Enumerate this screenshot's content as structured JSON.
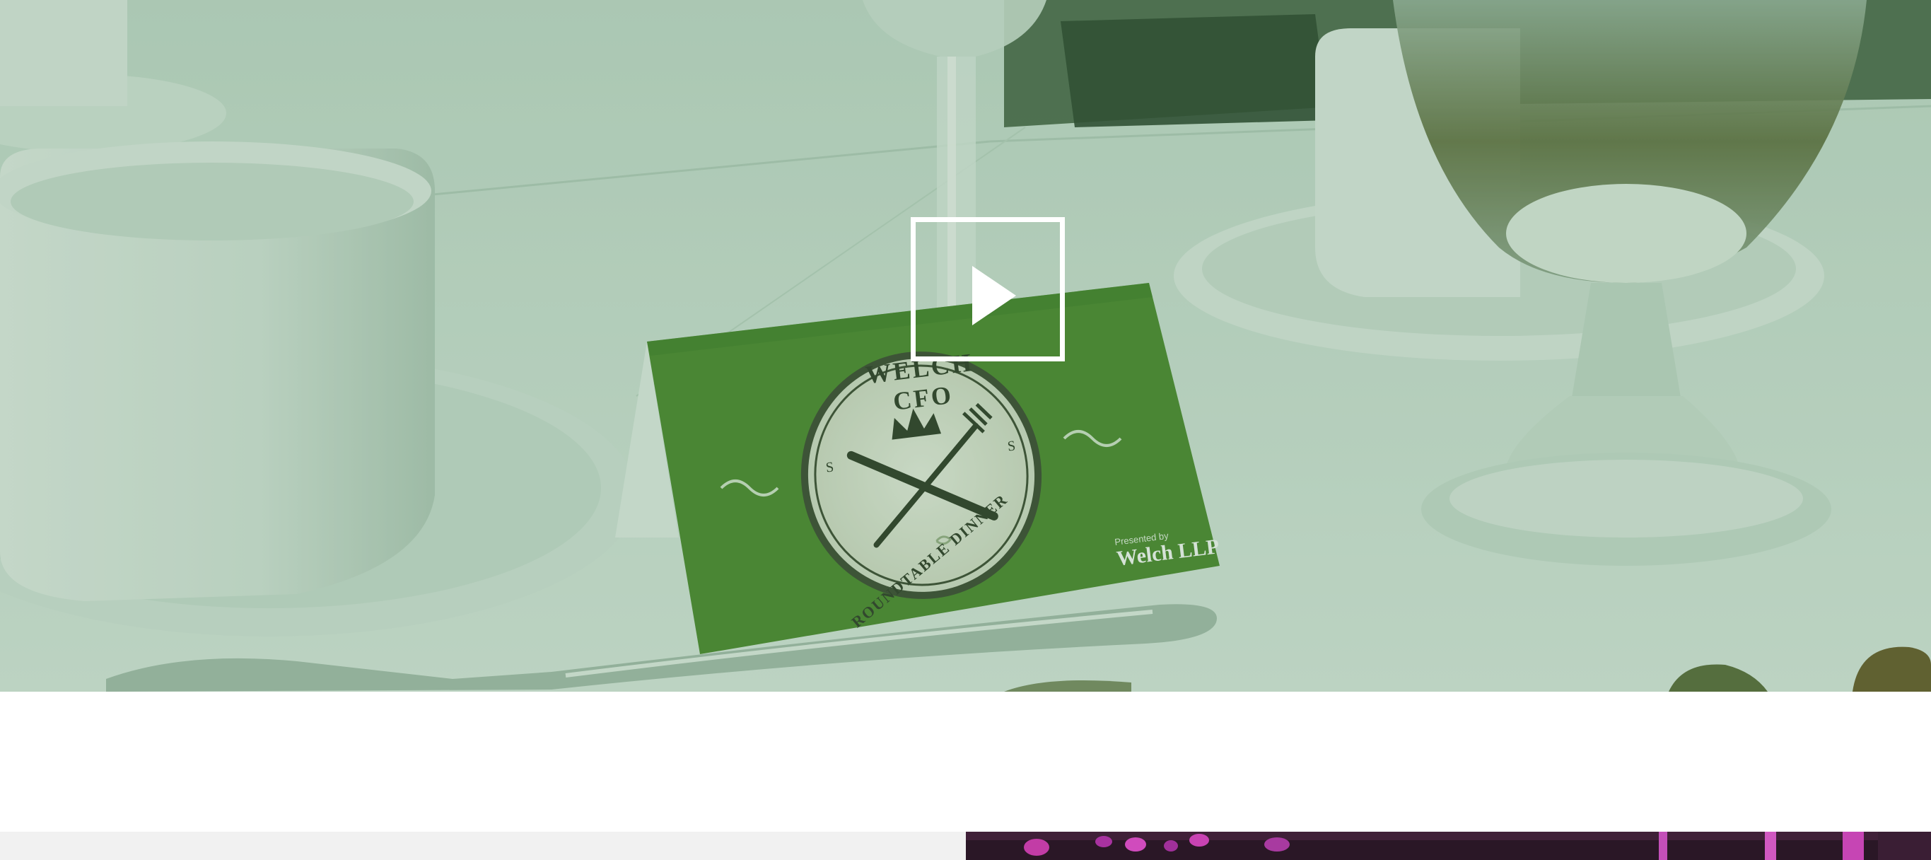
{
  "hero": {
    "media_type": "video",
    "overlay_color": "#3f7d4a",
    "place_card": {
      "emblem_title": "WELCH CFO",
      "emblem_subtitle": "ROUNDTABLE DINNER",
      "emblem_letter": "S",
      "presented_by": "Presented by",
      "brand": "Welch LLP",
      "card_color": "#4d8a2f"
    },
    "play_button_icon": "play-icon"
  },
  "next_section": {
    "left_panel_color": "#f1f1f1",
    "right_panel_color": "#2a1726"
  }
}
